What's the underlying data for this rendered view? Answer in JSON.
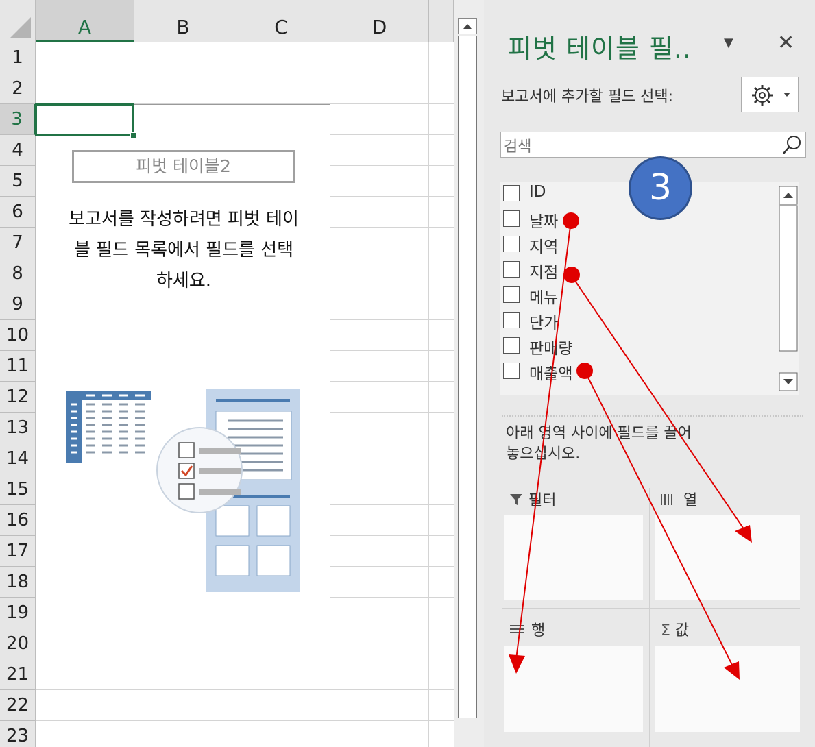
{
  "sheet": {
    "columns": [
      "A",
      "B",
      "C",
      "D"
    ],
    "rows": [
      "1",
      "2",
      "3",
      "4",
      "5",
      "6",
      "7",
      "8",
      "9",
      "10",
      "11",
      "12",
      "13",
      "14",
      "15",
      "16",
      "17",
      "18",
      "19",
      "20",
      "21",
      "22",
      "23"
    ],
    "selected_column": "A",
    "selected_row": "3",
    "pivot_placeholder": {
      "name": "피벗 테이블2",
      "instruction_line1": "보고서를 작성하려면 피벗 테이",
      "instruction_line2": "블 필드 목록에서 필드를 선택",
      "instruction_line3": "하세요."
    }
  },
  "panel": {
    "title": "피벗 테이블 필..",
    "dropdown_icon": "chevron-down-icon",
    "close_icon": "close-icon",
    "choose_label": "보고서에 추가할 필드 선택:",
    "settings_icon": "gear-icon",
    "search_placeholder": "검색",
    "fields": [
      {
        "label": "ID",
        "checked": false
      },
      {
        "label": "날짜",
        "checked": false
      },
      {
        "label": "지역",
        "checked": false
      },
      {
        "label": "지점",
        "checked": false
      },
      {
        "label": "메뉴",
        "checked": false
      },
      {
        "label": "단가",
        "checked": false
      },
      {
        "label": "판매량",
        "checked": false
      },
      {
        "label": "매출액",
        "checked": false
      }
    ],
    "drag_instruction_line1": "아래 영역 사이에 필드를 끌어",
    "drag_instruction_line2": "놓으십시오.",
    "areas": {
      "filter": {
        "label": "필터",
        "icon": "filter-icon"
      },
      "columns": {
        "label": "열",
        "icon": "columns-icon"
      },
      "rows": {
        "label": "행",
        "icon": "rows-icon"
      },
      "values": {
        "label": "값",
        "icon": "sigma-icon"
      }
    }
  },
  "annotation": {
    "step_number": "3",
    "badge_color": "#4472c4",
    "arrow_color": "#e00000"
  },
  "colors": {
    "excel_green": "#217346"
  }
}
